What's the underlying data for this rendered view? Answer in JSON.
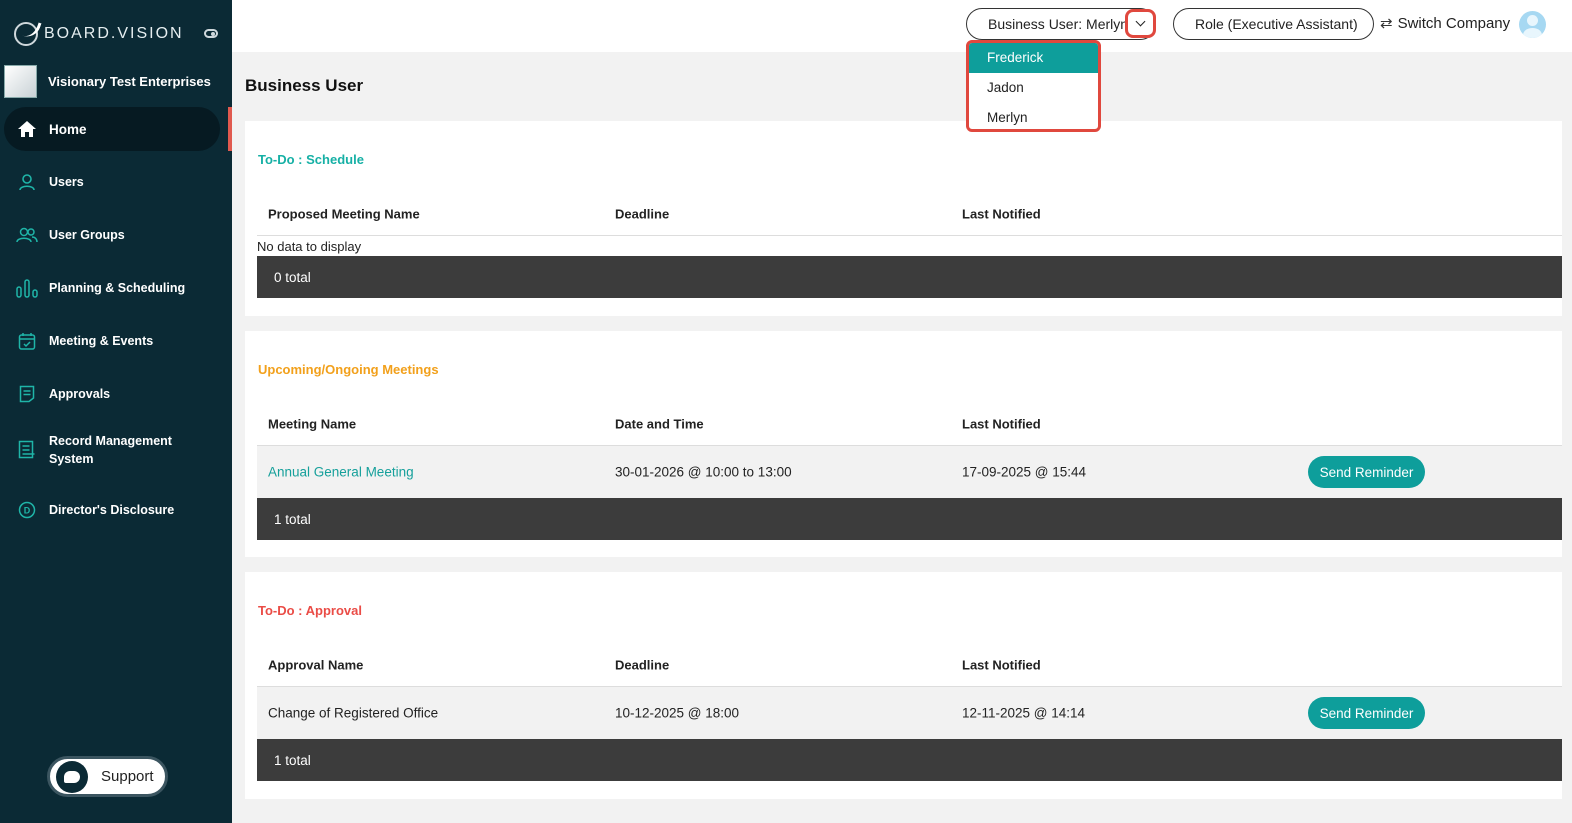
{
  "brand": {
    "name": "BOARD.VISION"
  },
  "company": {
    "name": "Visionary Test Enterprises"
  },
  "sidebar": {
    "items": [
      {
        "label": "Home",
        "icon": "home-icon"
      },
      {
        "label": "Users",
        "icon": "user-icon"
      },
      {
        "label": "User Groups",
        "icon": "user-group-icon"
      },
      {
        "label": "Planning & Scheduling",
        "icon": "planning-icon"
      },
      {
        "label": "Meeting & Events",
        "icon": "calendar-icon"
      },
      {
        "label": "Approvals",
        "icon": "approvals-icon"
      },
      {
        "label": "Record Management\nSystem",
        "icon": "record-icon"
      },
      {
        "label": "Director's Disclosure",
        "icon": "disclosure-icon"
      }
    ],
    "support_label": "Support"
  },
  "topbar": {
    "business_user": "Business User: Merlyn",
    "role": "Role (Executive Assistant)",
    "switch_company": "Switch Company"
  },
  "dropdown": {
    "options": [
      "Frederick",
      "Jadon",
      "Merlyn"
    ],
    "highlighted": "Frederick"
  },
  "page": {
    "title": "Business User"
  },
  "schedule": {
    "title": "To-Do : Schedule",
    "columns": [
      "Proposed Meeting Name",
      "Deadline",
      "Last Notified"
    ],
    "empty_text": "No data to display",
    "total": "0 total"
  },
  "meetings": {
    "title": "Upcoming/Ongoing Meetings",
    "columns": [
      "Meeting Name",
      "Date and Time",
      "Last Notified"
    ],
    "rows": [
      {
        "name": "Annual General Meeting",
        "datetime": "30-01-2026 @ 10:00 to 13:00",
        "last_notified": "17-09-2025 @ 15:44",
        "action": "Send Reminder"
      }
    ],
    "total": "1 total"
  },
  "approvals": {
    "title": "To-Do : Approval",
    "columns": [
      "Approval Name",
      "Deadline",
      "Last Notified"
    ],
    "rows": [
      {
        "name": "Change of Registered Office",
        "deadline": "10-12-2025 @ 18:00",
        "last_notified": "12-11-2025 @ 14:14",
        "action": "Send Reminder"
      }
    ],
    "total": "1 total"
  },
  "colors": {
    "sidebar": "#0b2a35",
    "accent": "#0e9e9b",
    "highlight": "#e0483e"
  }
}
